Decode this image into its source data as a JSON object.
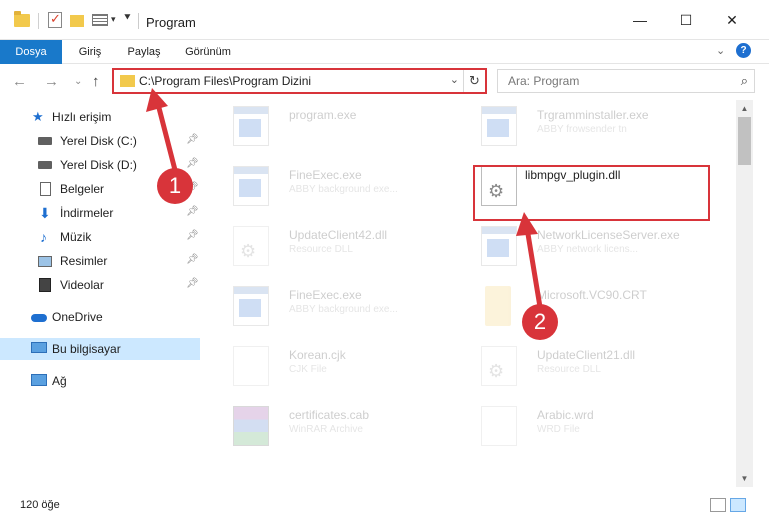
{
  "window": {
    "title": "Program",
    "minimize_glyph": "—",
    "maximize_glyph": "☐",
    "close_glyph": "✕"
  },
  "ribbon": {
    "tabs": [
      "Dosya",
      "Giriş",
      "Paylaş",
      "Görünüm"
    ],
    "expand_glyph": "⌄",
    "help_glyph": "?"
  },
  "address": {
    "path": "C:\\Program Files\\Program Dizini",
    "search_placeholder": "Ara: Program"
  },
  "sidebar": {
    "items": [
      {
        "label": "Hızlı erişim",
        "icon": "star-icon",
        "pinned": false
      },
      {
        "label": "Yerel Disk (C:)",
        "icon": "drive-icon",
        "pinned": true
      },
      {
        "label": "Yerel Disk (D:)",
        "icon": "drive-icon",
        "pinned": true
      },
      {
        "label": "Belgeler",
        "icon": "documents-icon",
        "pinned": true
      },
      {
        "label": "İndirmeler",
        "icon": "download-icon",
        "pinned": true
      },
      {
        "label": "Müzik",
        "icon": "music-icon",
        "pinned": true
      },
      {
        "label": "Resimler",
        "icon": "pictures-icon",
        "pinned": true
      },
      {
        "label": "Videolar",
        "icon": "video-icon",
        "pinned": true
      },
      {
        "label": "OneDrive",
        "icon": "cloud-icon",
        "pinned": false
      },
      {
        "label": "Bu bilgisayar",
        "icon": "computer-icon",
        "pinned": false,
        "selected": true
      },
      {
        "label": "Ağ",
        "icon": "network-icon",
        "pinned": false
      }
    ]
  },
  "files": [
    {
      "name": "program.exe",
      "type": "",
      "icon": "exe-icon"
    },
    {
      "name": "Trgramminstaller.exe",
      "type": "ABBY frowsender tn",
      "icon": "exe-icon"
    },
    {
      "name": "FineExec.exe",
      "type": "ABBY background exe...",
      "icon": "exe-icon"
    },
    {
      "name": "libmpgv_plugin.dll",
      "type": "",
      "icon": "dll-gear-icon"
    },
    {
      "name": "UpdateClient42.dll",
      "type": "Resource DLL",
      "icon": "dll-gear-icon"
    },
    {
      "name": "NetworkLicenseServer.exe",
      "type": "ABBY network licens...",
      "icon": "exe-icon"
    },
    {
      "name": "FineExec.exe",
      "type": "ABBY background exe...",
      "icon": "exe-icon"
    },
    {
      "name": "Microsoft.VC90.CRT",
      "type": "",
      "icon": "folder-icon"
    },
    {
      "name": "Korean.cjk",
      "type": "CJK File",
      "icon": "document-icon"
    },
    {
      "name": "UpdateClient21.dll",
      "type": "Resource DLL",
      "icon": "dll-gear-icon"
    },
    {
      "name": "certificates.cab",
      "type": "WinRAR Archive",
      "icon": "rar-icon"
    },
    {
      "name": "Arabic.wrd",
      "type": "WRD File",
      "icon": "document-icon"
    }
  ],
  "status": {
    "item_count": "120 öğe"
  },
  "annotations": {
    "step1": "1",
    "step2": "2"
  },
  "colors": {
    "accent": "#1979ca",
    "highlight_red": "#d8343a",
    "selected_bg": "#cce8ff"
  }
}
